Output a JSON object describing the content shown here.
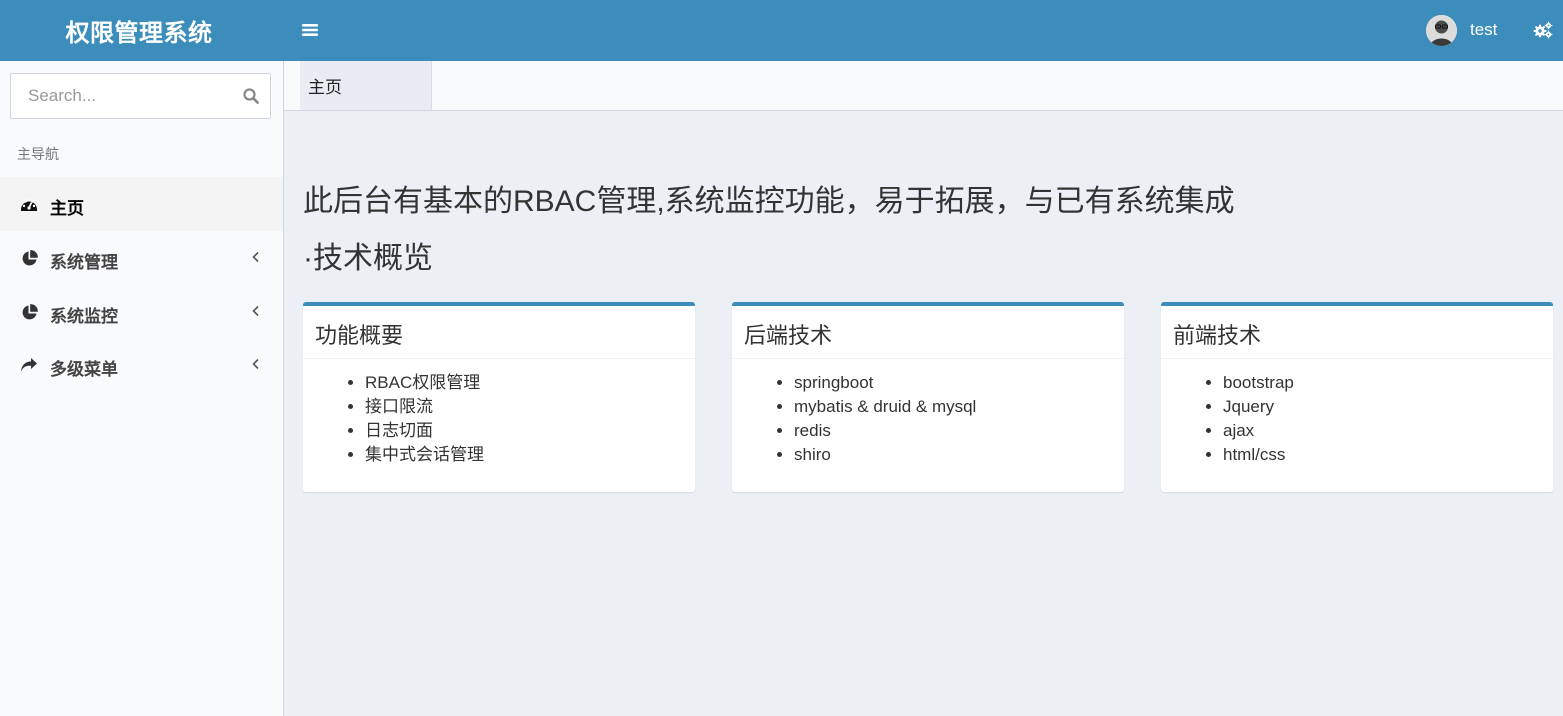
{
  "header": {
    "logo": "权限管理系统",
    "user_name": "test"
  },
  "sidebar": {
    "search_placeholder": "Search...",
    "nav_header": "主导航",
    "items": [
      {
        "label": "主页",
        "icon": "dashboard-icon"
      },
      {
        "label": "系统管理",
        "icon": "pie-chart-icon"
      },
      {
        "label": "系统监控",
        "icon": "pie-chart-icon"
      },
      {
        "label": "多级菜单",
        "icon": "share-arrow-icon"
      }
    ]
  },
  "tabs": [
    {
      "label": "主页"
    }
  ],
  "content": {
    "intro": "此后台有基本的RBAC管理,系统监控功能，易于拓展，与已有系统集成",
    "subtitle": "·技术概览",
    "boxes": [
      {
        "title": "功能概要",
        "items": [
          "RBAC权限管理",
          "接口限流",
          "日志切面",
          "集中式会话管理"
        ]
      },
      {
        "title": "后端技术",
        "items": [
          "springboot",
          "mybatis & druid & mysql",
          "redis",
          "shiro"
        ]
      },
      {
        "title": "前端技术",
        "items": [
          "bootstrap",
          "Jquery",
          "ajax",
          "html/css"
        ]
      }
    ]
  },
  "colors": {
    "header_bg": "#3c8dbc",
    "box_accent": "#3c8dbc",
    "content_bg": "#ecf0f5",
    "sidebar_bg": "#f9fafc"
  }
}
